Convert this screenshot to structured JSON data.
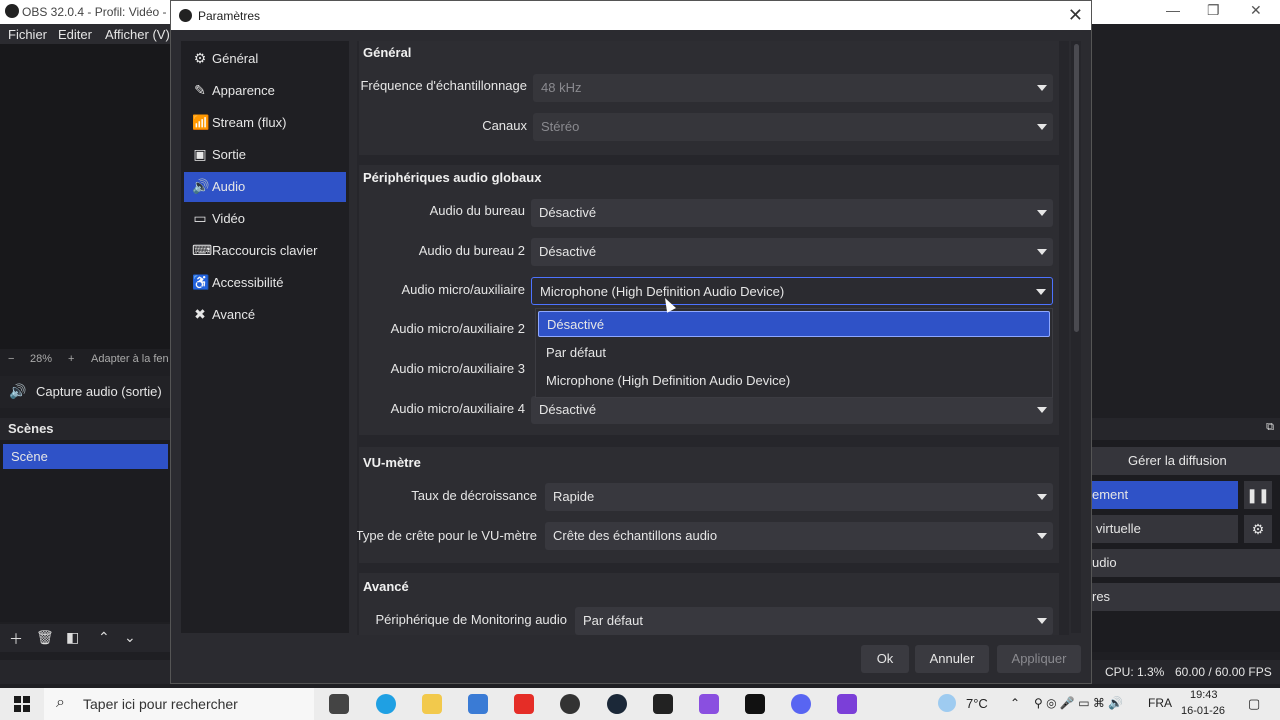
{
  "main_window": {
    "title": "OBS 32.0.4 - Profil: Vidéo - Sc",
    "menu": [
      "Fichier",
      "Editer",
      "Afficher (V)"
    ],
    "zoom": "28%",
    "zoom_minus": "−",
    "zoom_plus": "+",
    "fit_label": "Adapter à la fen",
    "audio_capture_label": "Capture audio (sortie)",
    "scenes_title": "Scènes",
    "scene_item": "Scène",
    "controls": {
      "manage_stream": "Gérer la diffusion",
      "recording": "ement",
      "virtual_cam": "virtuelle",
      "studio": "udio",
      "settings": "res"
    },
    "status": {
      "cpu": "CPU: 1.3%",
      "fps": "60.00 / 60.00 FPS"
    }
  },
  "dialog": {
    "title": "Paramètres",
    "nav": [
      {
        "label": "Général",
        "icon": "gear-icon",
        "glyph": "⚙"
      },
      {
        "label": "Apparence",
        "icon": "appearance-icon",
        "glyph": "✎"
      },
      {
        "label": "Stream (flux)",
        "icon": "antenna-icon",
        "glyph": "📶"
      },
      {
        "label": "Sortie",
        "icon": "output-icon",
        "glyph": "▣"
      },
      {
        "label": "Audio",
        "icon": "speaker-icon",
        "glyph": "🔊"
      },
      {
        "label": "Vidéo",
        "icon": "monitor-icon",
        "glyph": "▭"
      },
      {
        "label": "Raccourcis clavier",
        "icon": "keyboard-icon",
        "glyph": "⌨"
      },
      {
        "label": "Accessibilité",
        "icon": "accessibility-icon",
        "glyph": "♿"
      },
      {
        "label": "Avancé",
        "icon": "tools-icon",
        "glyph": "✖"
      }
    ],
    "selected_nav": "Audio",
    "general": {
      "title": "Général",
      "sample_rate_label": "Fréquence d'échantillonnage",
      "sample_rate_value": "48 kHz",
      "channels_label": "Canaux",
      "channels_value": "Stéréo"
    },
    "global_devices": {
      "title": "Périphériques audio globaux",
      "desktop1_label": "Audio du bureau",
      "desktop1_value": "Désactivé",
      "desktop2_label": "Audio du bureau 2",
      "desktop2_value": "Désactivé",
      "mic1_label": "Audio micro/auxiliaire",
      "mic1_value": "Microphone (High Definition Audio Device)",
      "mic2_label": "Audio micro/auxiliaire 2",
      "mic3_label": "Audio micro/auxiliaire 3",
      "mic4_label": "Audio micro/auxiliaire 4",
      "mic4_value": "Désactivé"
    },
    "dropdown_options": [
      "Désactivé",
      "Par défaut",
      "Microphone (High Definition Audio Device)"
    ],
    "vu_meter": {
      "title": "VU-mètre",
      "decay_label": "Taux de décroissance",
      "decay_value": "Rapide",
      "peak_label": "Type de crête pour le VU-mètre",
      "peak_value": "Crête des échantillons audio"
    },
    "advanced": {
      "title": "Avancé",
      "monitoring_label": "Périphérique de Monitoring audio",
      "monitoring_value": "Par défaut"
    },
    "buttons": {
      "ok": "Ok",
      "cancel": "Annuler",
      "apply": "Appliquer"
    }
  },
  "taskbar": {
    "search_placeholder": "Taper ici pour rechercher",
    "weather": "7°C",
    "language": "FRA",
    "time": "19:43",
    "date": "16-01-26"
  },
  "colors": {
    "accent": "#2f52c7",
    "dialog_bg": "#2b2b30",
    "panel_bg": "#1f1f23"
  }
}
